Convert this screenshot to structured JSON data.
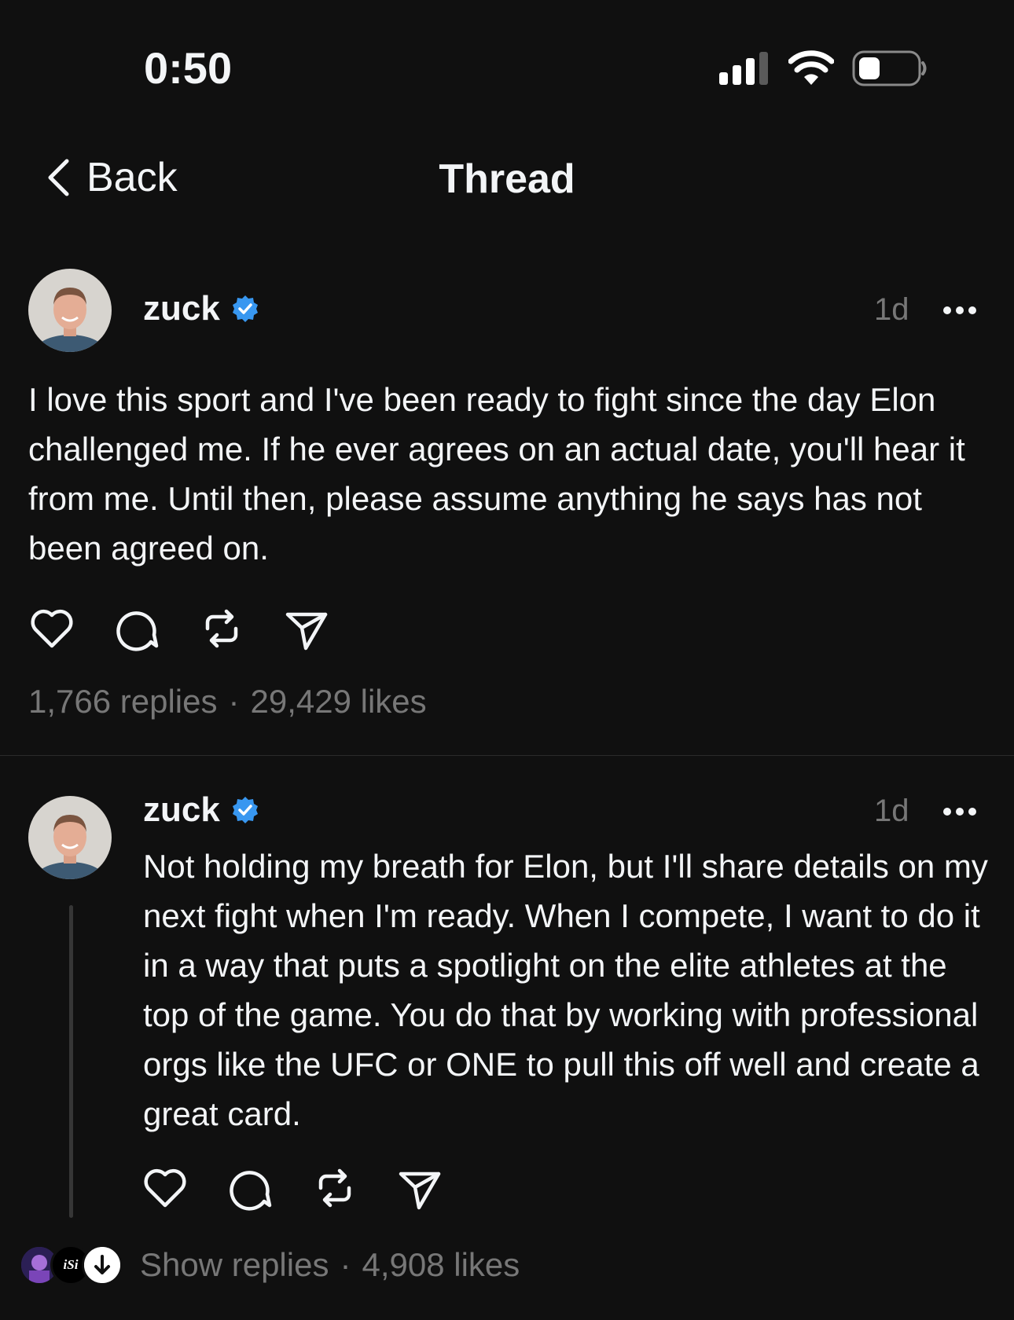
{
  "status_bar": {
    "time": "0:50"
  },
  "nav": {
    "back_label": "Back",
    "title": "Thread"
  },
  "posts": [
    {
      "username": "zuck",
      "time": "1d",
      "text": "I love this sport and I've been ready to fight since the day Elon challenged me. If he ever agrees on an actual date, you'll hear it from me. Until then, please assume anything he says has not been agreed on.",
      "replies": "1,766 replies",
      "likes": "29,429 likes"
    },
    {
      "username": "zuck",
      "time": "1d",
      "text": "Not holding my breath for Elon, but I'll share details on my next fight when I'm ready. When I compete, I want to do it in a way that puts a spotlight on the elite athletes at the top of the game. You do that by working with professional orgs like the UFC or ONE to pull this off well and create a great card.",
      "show_replies": "Show replies",
      "likes": "4,908 likes",
      "reply_avatar_text": "iSi"
    }
  ],
  "separator": "·",
  "icons": [
    "chevron-left-icon",
    "verified-badge-icon",
    "more-icon",
    "heart-icon",
    "comment-icon",
    "repost-icon",
    "send-icon",
    "arrow-down-icon",
    "cellular-signal-icon",
    "wifi-icon",
    "battery-icon"
  ],
  "colors": {
    "background": "#101010",
    "text": "#f3f5f7",
    "secondary_text": "#777777",
    "verified": "#3897f0",
    "divider": "#2b2b2b"
  }
}
